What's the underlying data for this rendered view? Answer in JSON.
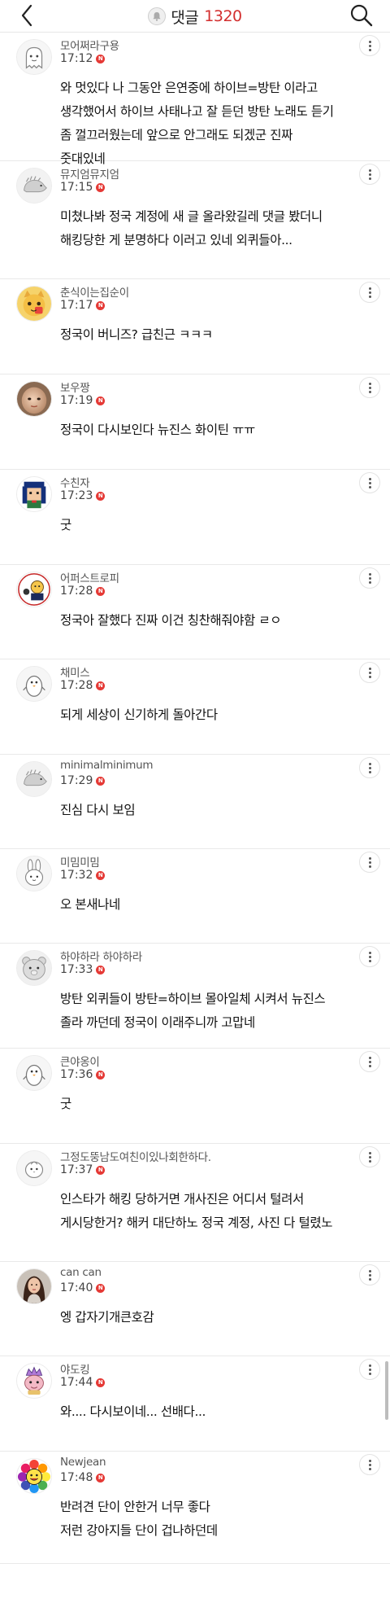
{
  "header": {
    "title": "댓글",
    "count": "1320"
  },
  "comments": [
    {
      "nickname": "모어쩌라구용",
      "time": "17:12",
      "badge": "N",
      "text": "와 멋있다 나 그동안 은연중에 하이브=방탄 이라고 생각했어서 하이브 사태나고 잘 듣던 방탄 노래도 듣기 좀 껄끄러웠는데 앞으로 안그래도 되겠군 진짜 줏대있네",
      "lines": [
        "와 멋있다 나 그동안 은연중에 하이브=방탄 이라고",
        "생각했어서 하이브 사태나고 잘 듣던 방탄 노래도 듣기",
        "좀 껄끄러웠는데 앞으로 안그래도 되겠군 진짜",
        "줏대있네"
      ],
      "avatar": "ghost-avatar"
    },
    {
      "nickname": "뮤지엄뮤지엄",
      "time": "17:15",
      "badge": "N",
      "text": "미쳤나봐 정국 계정에 새 글 올라왔길레 댓글 봤더니 해킹당한 게 분명하다 이러고 있네 외퀴들아...",
      "lines": [
        "미쳤나봐 정국 계정에 새 글 올라왔길레 댓글 봤더니",
        "해킹당한 게 분명하다 이러고 있네 외퀴들아..."
      ],
      "avatar": "hedgehog-avatar"
    },
    {
      "nickname": "춘식이는집순이",
      "time": "17:17",
      "badge": "N",
      "text": "정국이 버니즈? 급친근 ㅋㅋㅋ",
      "lines": [
        "정국이 버니즈? 급친근 ㅋㅋㅋ"
      ],
      "avatar": "yellow-cat-avatar"
    },
    {
      "nickname": "보우짱",
      "time": "17:19",
      "badge": "N",
      "text": "정국이 다시보인다 뉴진스 화이틴 ㅠㅠ",
      "lines": [
        "정국이 다시보인다 뉴진스 화이틴 ㅠㅠ"
      ],
      "avatar": "baby-photo-avatar"
    },
    {
      "nickname": "수친자",
      "time": "17:23",
      "badge": "N",
      "text": "굿",
      "lines": [
        "굿"
      ],
      "avatar": "pixel-character-avatar"
    },
    {
      "nickname": "어퍼스트로피",
      "time": "17:28",
      "badge": "N",
      "text": "정국아 잘했다 진짜 이건 칭찬해줘야함 ㄹㅇ",
      "lines": [
        "정국아 잘했다 진짜 이건 칭찬해줘야함 ㄹㅇ"
      ],
      "avatar": "cartoon-duo-avatar"
    },
    {
      "nickname": "채미스",
      "time": "17:28",
      "badge": "N",
      "text": "되게 세상이 신기하게 돌아간다",
      "lines": [
        "되게 세상이 신기하게 돌아간다"
      ],
      "avatar": "penguin-avatar"
    },
    {
      "nickname": "minimalminimum",
      "time": "17:29",
      "badge": "N",
      "text": "진심 다시 보임",
      "lines": [
        "진심 다시 보임"
      ],
      "avatar": "hedgehog-avatar"
    },
    {
      "nickname": "미밈미밈",
      "time": "17:32",
      "badge": "N",
      "text": "오 본새나네",
      "lines": [
        "오 본새나네"
      ],
      "avatar": "rabbit-avatar"
    },
    {
      "nickname": "하야하라 하야하라",
      "time": "17:33",
      "badge": "N",
      "text": "방탄 외퀴들이 방탄=하이브 몰아일체 시켜서 뉴진스 졸라 까던데 정국이 이래주니까 고맙네",
      "lines": [
        "방탄 외퀴들이 방탄=하이브 몰아일체 시켜서 뉴진스",
        "졸라 까던데 정국이 이래주니까 고맙네"
      ],
      "avatar": "bear-avatar"
    },
    {
      "nickname": "큰야옹이",
      "time": "17:36",
      "badge": "N",
      "text": "굿",
      "lines": [
        "굿"
      ],
      "avatar": "penguin-avatar"
    },
    {
      "nickname": "그정도뚱남도여친이있나회한하다.",
      "time": "17:37",
      "badge": "N",
      "text": "인스타가 해킹 당하거면 개사진은 어디서 털려서 게시당한거? 해커 대단하노 정국 계정, 사진 다 털렸노",
      "lines": [
        "인스타가 해킹 당하거면 개사진은 어디서 털려서",
        "게시당한거? 해커 대단하노 정국 계정, 사진 다 털렸노"
      ],
      "avatar": "bird-avatar"
    },
    {
      "nickname": "can can",
      "time": "17:40",
      "badge": "N",
      "text": "엥 갑자기개큰호감",
      "lines": [
        "엥 갑자기개큰호감"
      ],
      "avatar": "person-photo-avatar"
    },
    {
      "nickname": "야도킹",
      "time": "17:44",
      "badge": "N",
      "text": "와.... 다시보이네... 선배다...",
      "lines": [
        "와.... 다시보이네... 선배다..."
      ],
      "avatar": "crown-pokemon-avatar"
    },
    {
      "nickname": "Newjean",
      "time": "17:48",
      "badge": "N",
      "text": "반려견 단이 안한거 너무 좋다 저런 강아지들 단이 겁나하던데",
      "lines": [
        "반려견 단이 안한거 너무 좋다",
        "저런 강아지들 단이 겁나하던데"
      ],
      "avatar": "rainbow-flower-avatar"
    }
  ],
  "colors": {
    "accent": "#d32f2f",
    "badge": "#e53935",
    "divider": "#e9e9e9"
  }
}
